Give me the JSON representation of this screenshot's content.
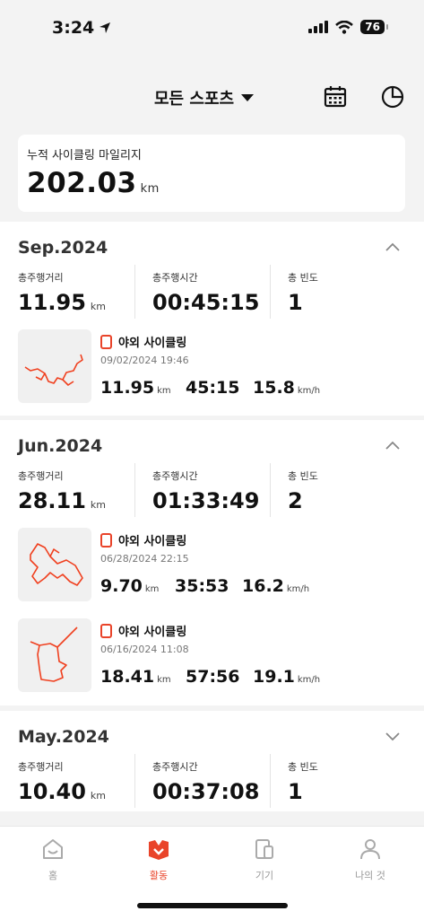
{
  "status_bar": {
    "time": "3:24",
    "battery": "76"
  },
  "header": {
    "sport_filter": "모든 스포츠"
  },
  "mileage": {
    "label": "누적 사이클링 마일리지",
    "value": "202.03",
    "unit": "km"
  },
  "stat_labels": {
    "distance": "총주행거리",
    "duration": "총주행시간",
    "frequency": "총 빈도"
  },
  "months": [
    {
      "title": "Sep.2024",
      "distance": "11.95",
      "distance_unit": "km",
      "duration": "00:45:15",
      "frequency": "1",
      "activities": [
        {
          "type": "야외 사이클링",
          "date": "09/02/2024 19:46",
          "distance": "11.95",
          "distance_unit": "km",
          "time": "45:15",
          "speed": "15.8",
          "speed_unit": "km/h"
        }
      ]
    },
    {
      "title": "Jun.2024",
      "distance": "28.11",
      "distance_unit": "km",
      "duration": "01:33:49",
      "frequency": "2",
      "activities": [
        {
          "type": "야외 사이클링",
          "date": "06/28/2024 22:15",
          "distance": "9.70",
          "distance_unit": "km",
          "time": "35:53",
          "speed": "16.2",
          "speed_unit": "km/h"
        },
        {
          "type": "야외 사이클링",
          "date": "06/16/2024 11:08",
          "distance": "18.41",
          "distance_unit": "km",
          "time": "57:56",
          "speed": "19.1",
          "speed_unit": "km/h"
        }
      ]
    },
    {
      "title": "May.2024",
      "distance": "10.40",
      "distance_unit": "km",
      "duration": "00:37:08",
      "frequency": "1"
    }
  ],
  "nav": {
    "home": "홈",
    "activity": "활동",
    "devices": "기기",
    "me": "나의 것"
  },
  "colors": {
    "accent": "#e9442a",
    "route": "#f0401f",
    "inactive": "#999999"
  }
}
